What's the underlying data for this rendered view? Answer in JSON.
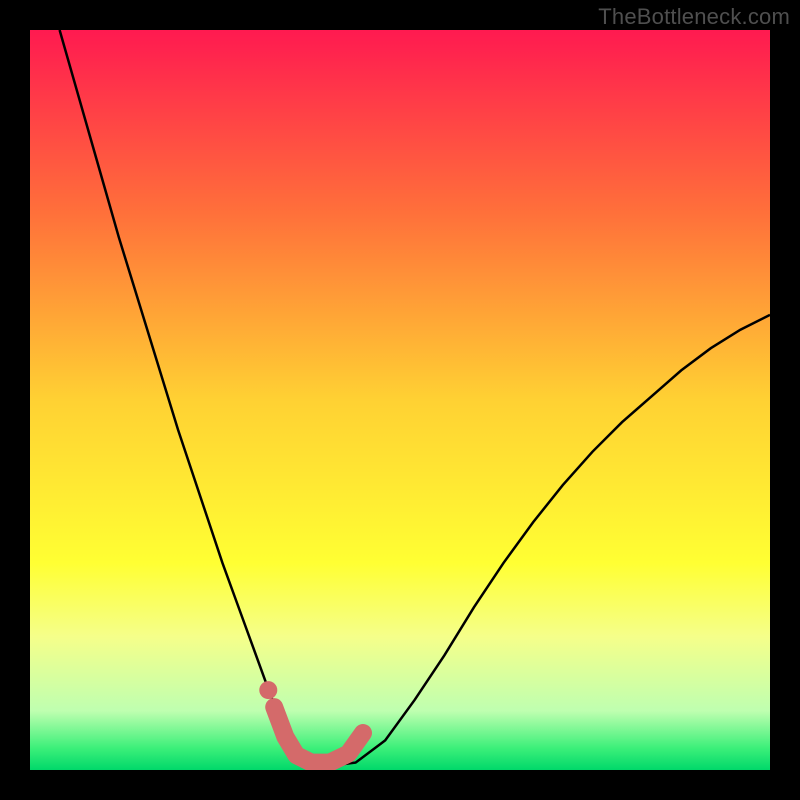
{
  "watermark": "TheBottleneck.com",
  "chart_data": {
    "type": "line",
    "title": "",
    "xlabel": "",
    "ylabel": "",
    "xlim": [
      0,
      1
    ],
    "ylim": [
      0,
      1
    ],
    "grid": false,
    "legend": false,
    "background_gradient": {
      "stops": [
        {
          "offset": 0.0,
          "color": "#ff1a50"
        },
        {
          "offset": 0.25,
          "color": "#ff713a"
        },
        {
          "offset": 0.5,
          "color": "#ffd133"
        },
        {
          "offset": 0.72,
          "color": "#ffff33"
        },
        {
          "offset": 0.82,
          "color": "#f5ff8a"
        },
        {
          "offset": 0.92,
          "color": "#bfffb0"
        },
        {
          "offset": 0.97,
          "color": "#3df07a"
        },
        {
          "offset": 1.0,
          "color": "#00d86a"
        }
      ]
    },
    "series": [
      {
        "name": "curve",
        "stroke": "#000000",
        "width": 2.5,
        "x": [
          0.04,
          0.06,
          0.08,
          0.1,
          0.12,
          0.14,
          0.16,
          0.18,
          0.2,
          0.22,
          0.24,
          0.26,
          0.28,
          0.3,
          0.32,
          0.335,
          0.35,
          0.37,
          0.4,
          0.44,
          0.48,
          0.52,
          0.56,
          0.6,
          0.64,
          0.68,
          0.72,
          0.76,
          0.8,
          0.84,
          0.88,
          0.92,
          0.96,
          1.0
        ],
        "y": [
          1.0,
          0.93,
          0.86,
          0.79,
          0.72,
          0.655,
          0.59,
          0.525,
          0.46,
          0.4,
          0.34,
          0.28,
          0.225,
          0.17,
          0.115,
          0.075,
          0.04,
          0.015,
          0.005,
          0.01,
          0.04,
          0.095,
          0.155,
          0.22,
          0.28,
          0.335,
          0.385,
          0.43,
          0.47,
          0.505,
          0.54,
          0.57,
          0.595,
          0.615
        ]
      },
      {
        "name": "valley-marker",
        "stroke": "#d46a6a",
        "width": 18,
        "linecap": "round",
        "x": [
          0.33,
          0.345,
          0.36,
          0.38,
          0.405,
          0.43,
          0.45
        ],
        "y": [
          0.085,
          0.045,
          0.02,
          0.01,
          0.01,
          0.022,
          0.05
        ]
      }
    ],
    "points": [
      {
        "name": "valley-dot",
        "x": 0.322,
        "y": 0.108,
        "r": 9,
        "fill": "#d46a6a"
      }
    ]
  }
}
